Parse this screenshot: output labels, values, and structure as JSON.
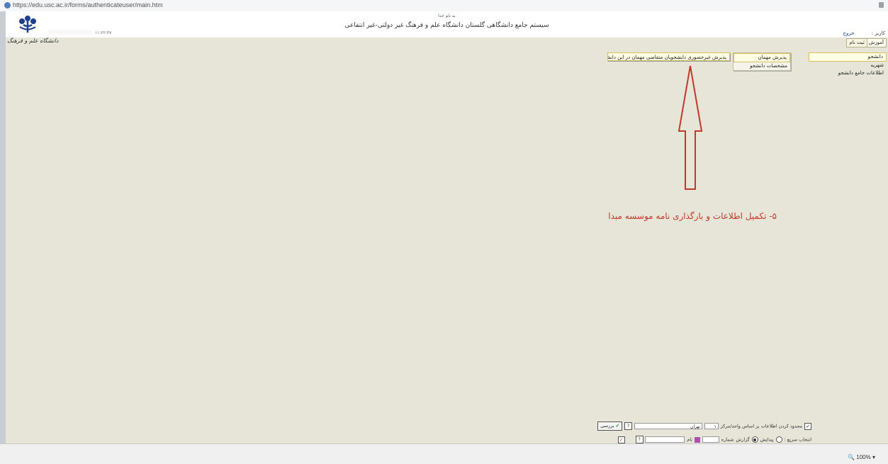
{
  "browser": {
    "url": "https://edu.usc.ac.ir/forms/authenticateuser/main.htm",
    "zoom": "100%"
  },
  "header": {
    "top_small": "به نام خدا",
    "title": "سیستم جامع دانشگاهی گلستان   دانشگاه علم و فرهنگ غیر دولتی-غیر انتفاعی",
    "clock": "۱۱:۲۲:۳۷",
    "university_signature": "دانشگاه علم و فرهنگ",
    "user_label": "کاربر :",
    "exit_label": "خروج"
  },
  "tabs": {
    "amuzesh": "آموزش",
    "sabt_nam": "ثبت نام"
  },
  "sidebar": {
    "items": [
      {
        "label": "دانشجو"
      },
      {
        "label": "شهریه"
      },
      {
        "label": "اطلاعات جامع دانشجو"
      }
    ]
  },
  "submenu": {
    "items": [
      {
        "label": "پذیرش مهمان"
      },
      {
        "label": "مشخصات دانشجو"
      }
    ]
  },
  "popup": {
    "label": "پذیرش غیرحضوری دانشجویان متقاضی مهمان در این دانشگاه"
  },
  "annotation": {
    "text": "۵- تکمیل اطلاعات و بارگذاری نامه موسسه مبدا",
    "color": "#c0392b"
  },
  "filter": {
    "limit_label": "محدود کردن اطلاعات بر اساس واحد/مرکز",
    "center_code": "۱",
    "center_name": "تهران",
    "barrasi_label": "بررسی",
    "quick_select_label": "انتخاب سریع :",
    "option_pidayesh": "پیدایش",
    "option_gozaresh": "گزارش",
    "number_label": "شماره",
    "name_label": "نام",
    "help_q": "?"
  }
}
